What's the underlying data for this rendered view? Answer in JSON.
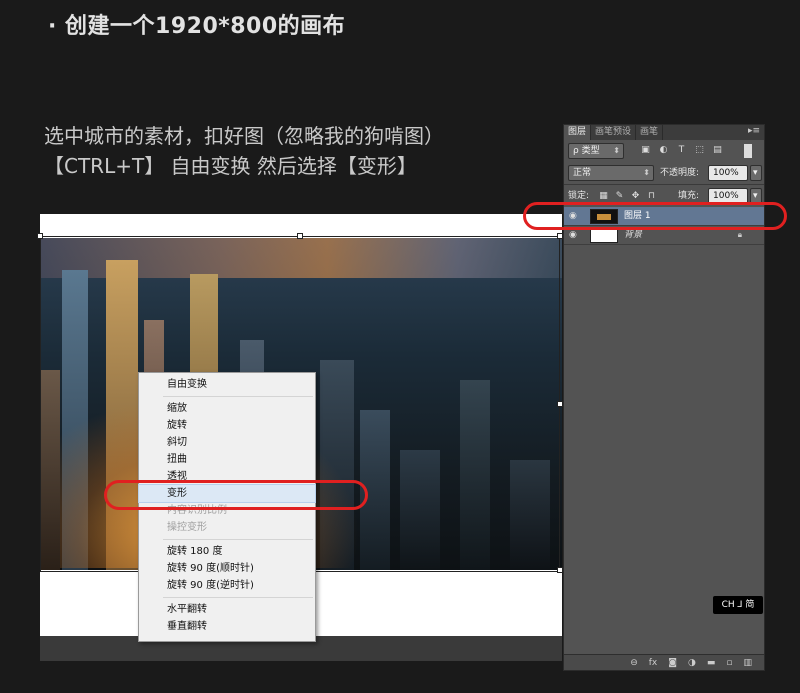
{
  "heading": "· 创建一个1920*800的画布",
  "instructions": {
    "line1": "选中城市的素材，扣好图（忽略我的狗啃图）",
    "line2": "【CTRL+T】 自由变换 然后选择【变形】"
  },
  "context_menu": {
    "items": [
      {
        "label": "自由变换",
        "enabled": true
      },
      {
        "label": "缩放",
        "enabled": true
      },
      {
        "label": "旋转",
        "enabled": true
      },
      {
        "label": "斜切",
        "enabled": true
      },
      {
        "label": "扭曲",
        "enabled": true
      },
      {
        "label": "透视",
        "enabled": true
      },
      {
        "label": "变形",
        "enabled": true,
        "highlighted": true
      },
      {
        "label": "内容识别比例",
        "enabled": false
      },
      {
        "label": "操控变形",
        "enabled": false
      },
      {
        "label": "旋转 180 度",
        "enabled": true
      },
      {
        "label": "旋转 90 度(顺时针)",
        "enabled": true
      },
      {
        "label": "旋转 90 度(逆时针)",
        "enabled": true
      },
      {
        "label": "水平翻转",
        "enabled": true
      },
      {
        "label": "垂直翻转",
        "enabled": true
      }
    ]
  },
  "layers_panel": {
    "tabs": [
      "图层",
      "画笔预设",
      "画笔"
    ],
    "active_tab": "图层",
    "filter": "ρ 类型",
    "blend_mode": "正常",
    "opacity_label": "不透明度:",
    "opacity_value": "100%",
    "lock_label": "锁定:",
    "fill_label": "填充:",
    "fill_value": "100%",
    "layers": [
      {
        "name": "图层 1",
        "active": true
      },
      {
        "name": "背景",
        "active": false,
        "locked": true
      }
    ]
  },
  "ime_indicator": "CH ⅃ 简",
  "colors": {
    "background": "#1a1a1a",
    "highlight_oval": "#e02020",
    "active_layer": "#627793",
    "panel": "#535353"
  }
}
